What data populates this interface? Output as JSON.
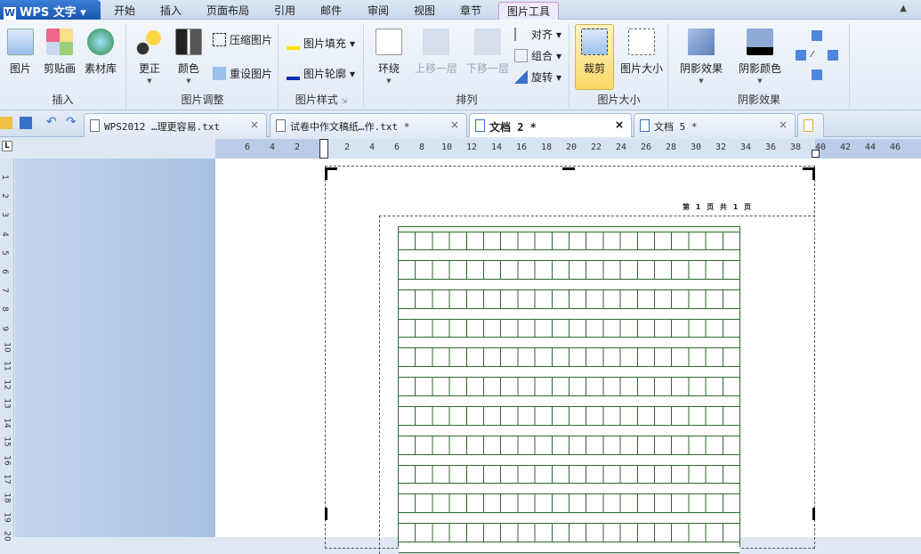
{
  "app": {
    "logo": "W",
    "name": "WPS 文字"
  },
  "menu": [
    "开始",
    "插入",
    "页面布局",
    "引用",
    "邮件",
    "审阅",
    "视图",
    "章节",
    "图片工具"
  ],
  "ribbon": {
    "insert": {
      "label": "插入",
      "items": [
        "图片",
        "剪贴画",
        "素材库"
      ]
    },
    "adjust": {
      "label": "图片调整",
      "items": [
        "更正",
        "颜色"
      ],
      "compress": "压缩图片",
      "reset": "重设图片"
    },
    "style": {
      "label": "图片样式",
      "fill": "图片填充",
      "outline": "图片轮廓"
    },
    "arrange": {
      "label": "排列",
      "wrap": "环绕",
      "forward": "上移一层",
      "backward": "下移一层",
      "align": "对齐",
      "group": "组合",
      "rotate": "旋转"
    },
    "size": {
      "label": "图片大小",
      "crop": "裁剪",
      "size": "图片大小"
    },
    "shadow": {
      "label": "阴影效果",
      "effect": "阴影效果",
      "color": "阴影颜色"
    }
  },
  "tabs": [
    {
      "title": "WPS2012 …理更容易.txt",
      "close": "×"
    },
    {
      "title": "试卷中作文稿纸…作.txt *",
      "close": "×"
    },
    {
      "title": "文档 2 *",
      "close": "×"
    },
    {
      "title": "文档 5 *",
      "close": "×"
    }
  ],
  "ruler": {
    "corner": "L",
    "h": [
      "6",
      "4",
      "2",
      "2",
      "4",
      "6",
      "8",
      "10",
      "12",
      "14",
      "16",
      "18",
      "20",
      "22",
      "24",
      "26",
      "28",
      "30",
      "32",
      "34",
      "36",
      "38",
      "40",
      "42",
      "44",
      "46"
    ],
    "v": [
      "1",
      "2",
      "3",
      "4",
      "5",
      "6",
      "7",
      "8",
      "9",
      "10",
      "11",
      "12",
      "13",
      "14",
      "15",
      "16",
      "17",
      "18",
      "19",
      "20"
    ]
  },
  "document": {
    "header": "第 1 页 共 1 页"
  },
  "colors": {
    "grid": "#2d6a2d",
    "accent": "#1a55b0"
  }
}
